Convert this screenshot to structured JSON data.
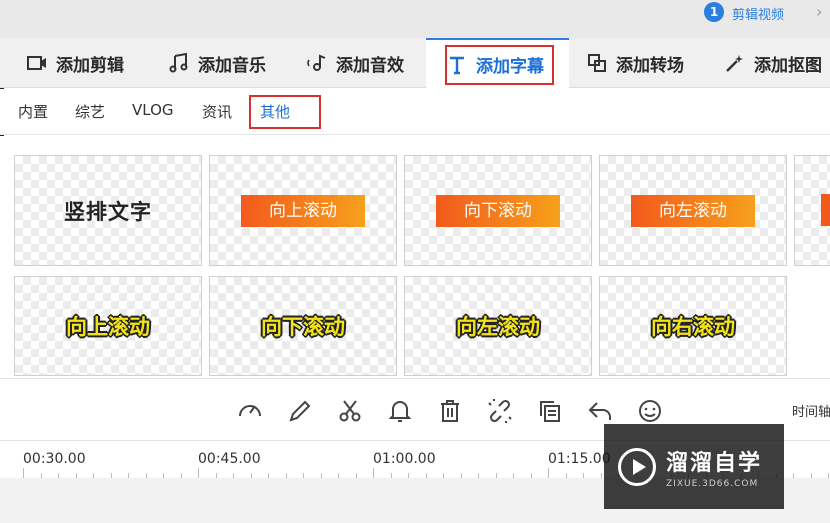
{
  "step": {
    "number": "1",
    "label": "剪辑视频"
  },
  "tabs": [
    {
      "label": "添加剪辑",
      "icon": "video-camera-icon"
    },
    {
      "label": "添加音乐",
      "icon": "music-note-icon"
    },
    {
      "label": "添加音效",
      "icon": "sound-effect-icon"
    },
    {
      "label": "添加字幕",
      "icon": "text-t-icon",
      "active": true
    },
    {
      "label": "添加转场",
      "icon": "transition-icon"
    },
    {
      "label": "添加抠图",
      "icon": "magic-wand-icon"
    }
  ],
  "subtabs": [
    {
      "label": "内置"
    },
    {
      "label": "综艺"
    },
    {
      "label": "VLOG"
    },
    {
      "label": "资讯"
    },
    {
      "label": "其他",
      "active": true
    }
  ],
  "templates_row1": [
    {
      "label": "竖排文字",
      "style": "vertical-text"
    },
    {
      "label": "向上滚动",
      "style": "orange-pill"
    },
    {
      "label": "向下滚动",
      "style": "orange-pill"
    },
    {
      "label": "向左滚动",
      "style": "orange-pill"
    }
  ],
  "templates_row2": [
    {
      "label": "向上滚动",
      "style": "yellow-outline"
    },
    {
      "label": "向下滚动",
      "style": "yellow-outline"
    },
    {
      "label": "向左滚动",
      "style": "yellow-outline"
    },
    {
      "label": "向右滚动",
      "style": "yellow-outline"
    }
  ],
  "toolbar_icons": [
    "speed-gauge-icon",
    "pencil-icon",
    "scissors-icon",
    "bell-icon",
    "trash-icon",
    "unlink-icon",
    "copy-icon",
    "undo-icon",
    "emoji-icon"
  ],
  "timeline_label": "时间轴",
  "ruler_times": [
    "00:30.00",
    "00:45.00",
    "01:00.00",
    "01:15.00"
  ],
  "watermark": {
    "title": "溜溜自学",
    "subtitle": "ZIXUE.3D66.COM"
  },
  "colors": {
    "accent": "#1a6fd8",
    "highlight_box": "#d83030",
    "pill_start": "#f25a1c",
    "pill_end": "#f7a01c",
    "caption_yellow": "#f2e21a"
  }
}
